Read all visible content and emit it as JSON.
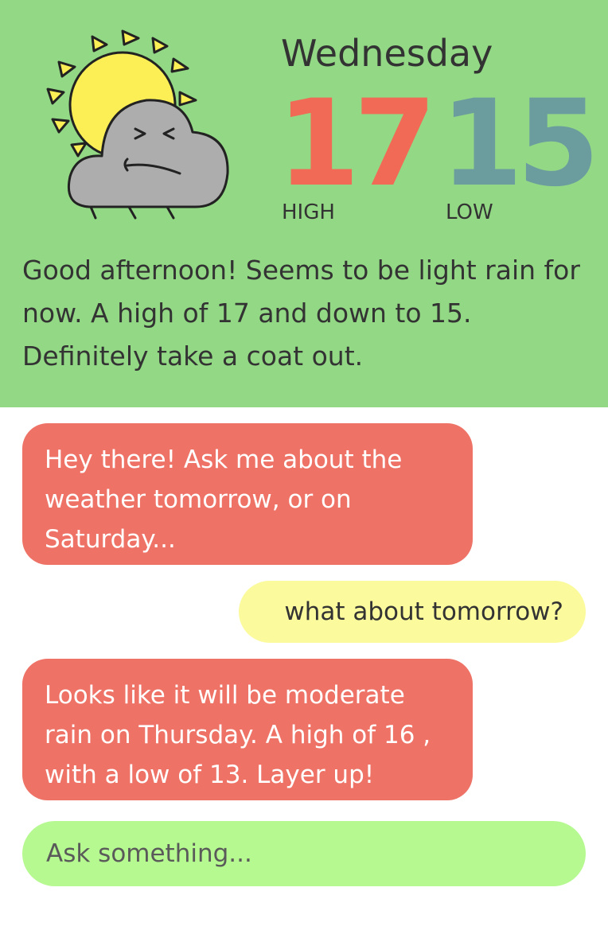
{
  "weather": {
    "day": "Wednesday",
    "high": "17",
    "low": "15",
    "high_label": "HIGH",
    "low_label": "LOW",
    "high_color": "#f06a55",
    "low_color": "#6b9c9e",
    "icon": "sun-behind-rain-cloud-icon",
    "summary": "Good afternoon! Seems to be light rain for now. A high of 17 and down to 15. Definitely take a coat out."
  },
  "colors": {
    "header_bg": "#93d985",
    "bot_bubble": "#ee7266",
    "user_bubble": "#fbfa9d",
    "input_bg": "#b6f990"
  },
  "chat": {
    "messages": [
      {
        "from": "bot",
        "text": "Hey there! Ask me about the weather tomorrow, or on Saturday..."
      },
      {
        "from": "user",
        "text": "what about tomorrow?"
      },
      {
        "from": "bot",
        "text": "Looks like it will be moderate rain on Thursday. A high of 16 , with a low of 13. Layer up!"
      }
    ]
  },
  "input": {
    "placeholder": "Ask something...",
    "value": ""
  }
}
